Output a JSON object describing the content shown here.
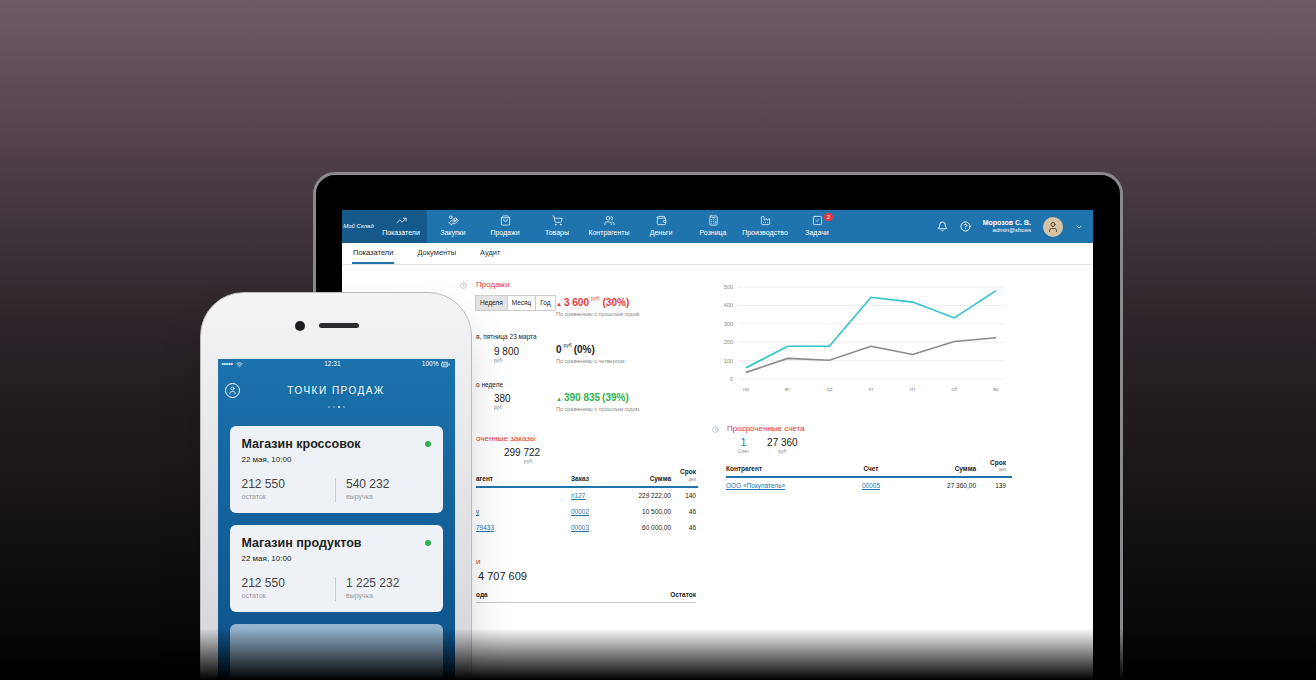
{
  "laptop": {
    "logo": "Мой Склад",
    "nav": [
      {
        "label": "Показатели",
        "selected": true
      },
      {
        "label": "Закупки",
        "selected": false
      },
      {
        "label": "Продажи",
        "selected": false
      },
      {
        "label": "Товары",
        "selected": false
      },
      {
        "label": "Контрагенты",
        "selected": false
      },
      {
        "label": "Деньги",
        "selected": false
      },
      {
        "label": "Розница",
        "selected": false
      },
      {
        "label": "Производство",
        "selected": false
      },
      {
        "label": "Задачи",
        "selected": false,
        "badge": "2"
      }
    ],
    "user": {
      "name": "Морозов С. В.",
      "login": "admin@shoes"
    },
    "subtabs": [
      {
        "label": "Показатели",
        "selected": true
      },
      {
        "label": "Документы",
        "selected": false
      },
      {
        "label": "Аудит",
        "selected": false
      }
    ],
    "sales": {
      "title": "Продажи",
      "periods": [
        {
          "label": "Неделя",
          "selected": true
        },
        {
          "label": "Месяц",
          "selected": false
        },
        {
          "label": "Год",
          "selected": false
        }
      ],
      "rows": [
        {
          "change": {
            "arrow": "▲",
            "value": "3 600",
            "unit": "руб.",
            "percent": "(30%)",
            "note": "По сравнению с прошлым годом",
            "color": "#e5383b"
          }
        },
        {
          "label": "я, пятница 23 марта",
          "value": "9 800",
          "unit": "руб",
          "change": {
            "value": "0",
            "unit": "руб",
            "percent": "(0%)",
            "note": "По сравнению с четвергом",
            "color": "#222222"
          }
        },
        {
          "label": "о неделе",
          "value": "380",
          "unit": "руб",
          "change": {
            "arrow": "▲",
            "value": "390 835",
            "percent": "(39%)",
            "note": "По сравнению с прошлым годом",
            "color": "#2fb34a"
          }
        }
      ]
    },
    "orders": {
      "title": "оченные заказы",
      "total": "299 722",
      "unit": "руб",
      "columns": [
        {
          "label": "агент"
        },
        {
          "label": "Заказ"
        },
        {
          "label": "Сумма"
        },
        {
          "label": "Срок",
          "sub": "дни"
        }
      ],
      "rows": [
        {
          "agent": "",
          "order": "n127",
          "sum": "229 222,00",
          "term": "140"
        },
        {
          "agent": "у",
          "order": "00002",
          "sum": "10 500,00",
          "term": "46"
        },
        {
          "agent": "79433",
          "order": "00003",
          "sum": "60 000,00",
          "term": "46"
        }
      ]
    },
    "money": {
      "title": "и",
      "total": "4 707 609",
      "columns": [
        {
          "label": "ода"
        },
        {
          "label": "Остаток"
        }
      ]
    },
    "chart": {
      "y_ticks": [
        "500",
        "400",
        "300",
        "200",
        "100",
        "0"
      ],
      "x_labels": [
        "пн",
        "вт",
        "ср",
        "чт",
        "пт",
        "сб",
        "вс"
      ],
      "series": [
        {
          "values": [
            61,
            178,
            178,
            444,
            418,
            332,
            480
          ],
          "color": "#2ec4cc"
        },
        {
          "values": [
            36,
            112,
            102,
            178,
            133,
            204,
            224
          ],
          "color": "#8a8a8a"
        }
      ]
    },
    "invoices": {
      "title": "Просроченные счета",
      "count": "1",
      "count_label": "Счет",
      "total": "27 360",
      "unit": "руб",
      "columns": [
        {
          "label": "Контрагент"
        },
        {
          "label": "Счет"
        },
        {
          "label": "Сумма"
        },
        {
          "label": "Срок",
          "sub": "дни"
        }
      ],
      "rows": [
        {
          "agent": "ООО «Покупатель»",
          "invoice": "00005",
          "sum": "27 360,00",
          "term": "139"
        }
      ]
    }
  },
  "phone": {
    "status": {
      "signal": "•••••",
      "time": "12:31",
      "battery": "100%"
    },
    "title": "ТОЧКИ ПРОДАЖ",
    "pages": [
      {
        "selected": false
      },
      {
        "selected": false
      },
      {
        "selected": true
      },
      {
        "selected": false
      }
    ],
    "cards": [
      {
        "name": "Магазин кроссовок",
        "date": "22 мая, 10:00",
        "online": true,
        "stock": "212 550",
        "stock_label": "остаток",
        "revenue": "540 232",
        "revenue_label": "выручка"
      },
      {
        "name": "Магазин продуктов",
        "date": "22 мая, 10:00",
        "online": true,
        "stock": "212 550",
        "stock_label": "остаток",
        "revenue": "1 225 232",
        "revenue_label": "выручка"
      }
    ]
  }
}
